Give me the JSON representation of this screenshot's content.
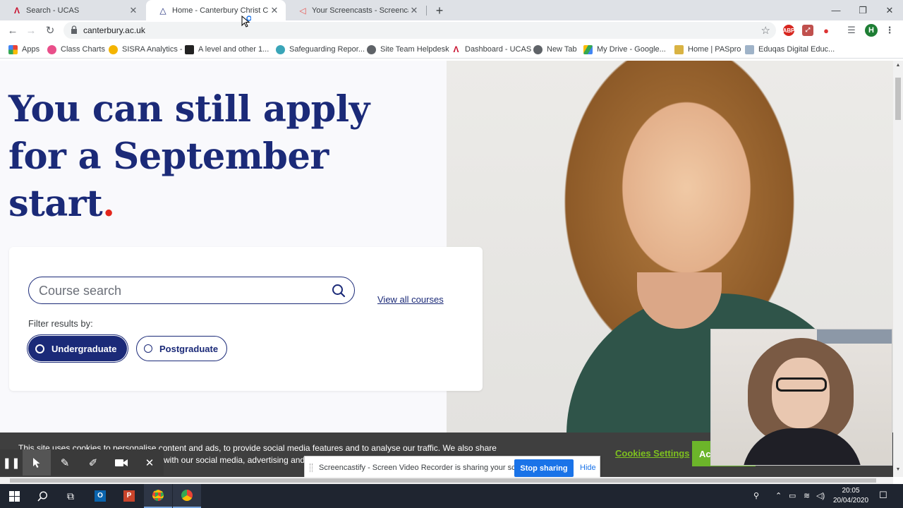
{
  "browser": {
    "tabs": [
      {
        "label": "Search - UCAS",
        "icon": "ucas-icon",
        "active": false
      },
      {
        "label": "Home - Canterbury Christ Church",
        "icon": "canterbury-icon",
        "active": true
      },
      {
        "label": "Your Screencasts - Screencastify",
        "icon": "screencastify-icon",
        "active": false
      }
    ],
    "url": "canterbury.ac.uk",
    "avatar_initial": "H",
    "bookmarks": [
      {
        "label": "Apps"
      },
      {
        "label": "Class Charts"
      },
      {
        "label": "SISRA Analytics -"
      },
      {
        "label": "A level and other 1..."
      },
      {
        "label": "Safeguarding Repor..."
      },
      {
        "label": "Site Team Helpdesk"
      },
      {
        "label": "Dashboard - UCAS"
      },
      {
        "label": "New Tab"
      },
      {
        "label": "My Drive - Google..."
      },
      {
        "label": "Home | PASpro"
      },
      {
        "label": "Eduqas Digital Educ..."
      }
    ],
    "extensions": [
      "ABP"
    ]
  },
  "page": {
    "hero_line1": "You can still apply",
    "hero_line2": "for a September",
    "hero_line3": "start",
    "hero_dot": ".",
    "search_placeholder": "Course search",
    "view_all": "View all courses",
    "filter_label": "Filter results by:",
    "filter_options": [
      "Undergraduate",
      "Postgraduate"
    ],
    "selected_filter": "Undergraduate"
  },
  "cookie_banner": {
    "line1": "This site uses cookies to personalise content and ads, to provide social media features and to analyse our traffic. We also share",
    "line2": "with our social media, advertising and",
    "settings_label": "Cookies Settings",
    "accept_label": "Acc"
  },
  "screencastify": {
    "share_text": "Screencastify - Screen Video Recorder is sharing your screen.",
    "stop_label": "Stop sharing",
    "hide_label": "Hide"
  },
  "taskbar": {
    "time": "20:05",
    "date": "20/04/2020"
  },
  "colors": {
    "brand_navy": "#1b2a78",
    "brand_red": "#e3261c",
    "cookie_green": "#6cb52a",
    "share_blue": "#1a73e8"
  }
}
